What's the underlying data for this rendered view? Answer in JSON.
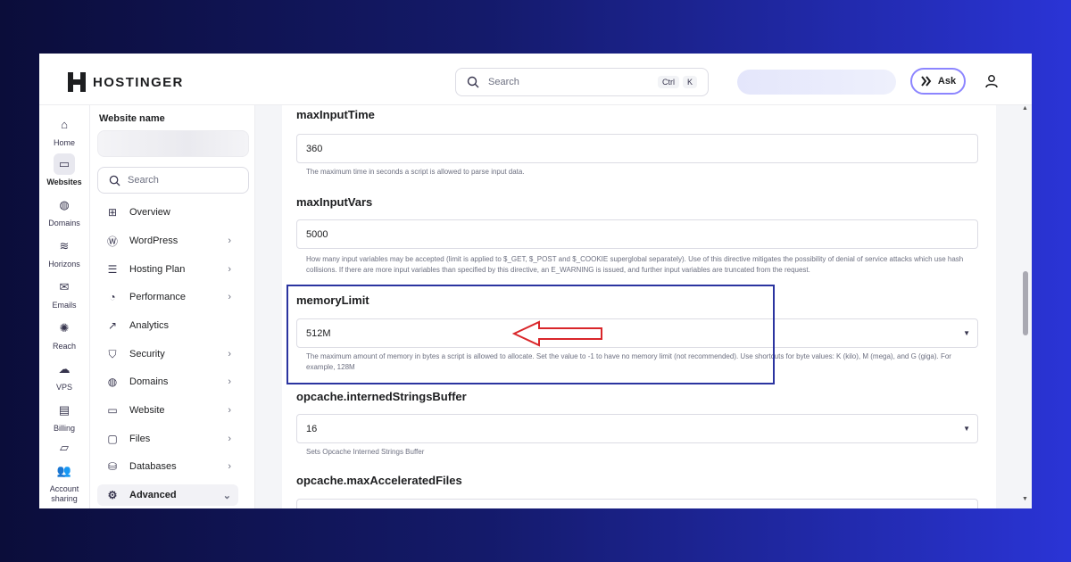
{
  "header": {
    "brand": "HOSTINGER",
    "search_placeholder": "Search",
    "shortcut_keys": [
      "Ctrl",
      "K"
    ],
    "ask_label": "Ask"
  },
  "rail": [
    {
      "label": "Home",
      "icon": "home-icon"
    },
    {
      "label": "Websites",
      "icon": "websites-icon",
      "active": true
    },
    {
      "label": "Domains",
      "icon": "globe-icon"
    },
    {
      "label": "Horizons",
      "icon": "horizons-icon"
    },
    {
      "label": "Emails",
      "icon": "mail-icon"
    },
    {
      "label": "Reach",
      "icon": "reach-icon"
    },
    {
      "label": "VPS",
      "icon": "vps-icon"
    },
    {
      "label": "Billing",
      "icon": "billing-icon"
    },
    {
      "label": "",
      "icon": "device-icon"
    },
    {
      "label": "Account sharing",
      "icon": "account-sharing-icon"
    }
  ],
  "sidebar": {
    "website_label": "Website name",
    "search_placeholder": "Search",
    "items": [
      {
        "label": "Overview",
        "icon": "overview-icon",
        "chevron": false
      },
      {
        "label": "WordPress",
        "icon": "wordpress-icon",
        "chevron": true
      },
      {
        "label": "Hosting Plan",
        "icon": "server-icon",
        "chevron": true
      },
      {
        "label": "Performance",
        "icon": "performance-icon",
        "chevron": true
      },
      {
        "label": "Analytics",
        "icon": "analytics-icon",
        "chevron": false
      },
      {
        "label": "Security",
        "icon": "shield-icon",
        "chevron": true
      },
      {
        "label": "Domains",
        "icon": "globe-icon",
        "chevron": true
      },
      {
        "label": "Website",
        "icon": "browser-icon",
        "chevron": true
      },
      {
        "label": "Files",
        "icon": "folder-icon",
        "chevron": true
      },
      {
        "label": "Databases",
        "icon": "database-icon",
        "chevron": true
      },
      {
        "label": "Advanced",
        "icon": "gear-icon",
        "chevron": true,
        "active": true
      }
    ]
  },
  "settings": [
    {
      "name": "maxInputTime",
      "value": "360",
      "dropdown": false,
      "help": "The maximum time in seconds a script is allowed to parse input data."
    },
    {
      "name": "maxInputVars",
      "value": "5000",
      "dropdown": false,
      "help": "How many input variables may be accepted (limit is applied to $_GET, $_POST and $_COOKIE superglobal separately). Use of this directive mitigates the possibility of denial of service attacks which use hash collisions. If there are more input variables than specified by this directive, an E_WARNING is issued, and further input variables are truncated from the request."
    },
    {
      "name": "memoryLimit",
      "value": "512M",
      "dropdown": true,
      "help": "The maximum amount of memory in bytes a script is allowed to allocate. Set the value to -1 to have no memory limit (not recommended). Use shortcuts for byte values: K (kilo), M (mega), and G (giga). For example, 128M"
    },
    {
      "name": "opcache.internedStringsBuffer",
      "value": "16",
      "dropdown": true,
      "help": "Sets Opcache Interned Strings Buffer"
    },
    {
      "name": "opcache.maxAcceleratedFiles",
      "value": "",
      "dropdown": false,
      "help": ""
    }
  ],
  "colors": {
    "highlight_box": "#2b34a0",
    "annotation_arrow": "#d9262a",
    "ask_border": "#8c85ff"
  }
}
